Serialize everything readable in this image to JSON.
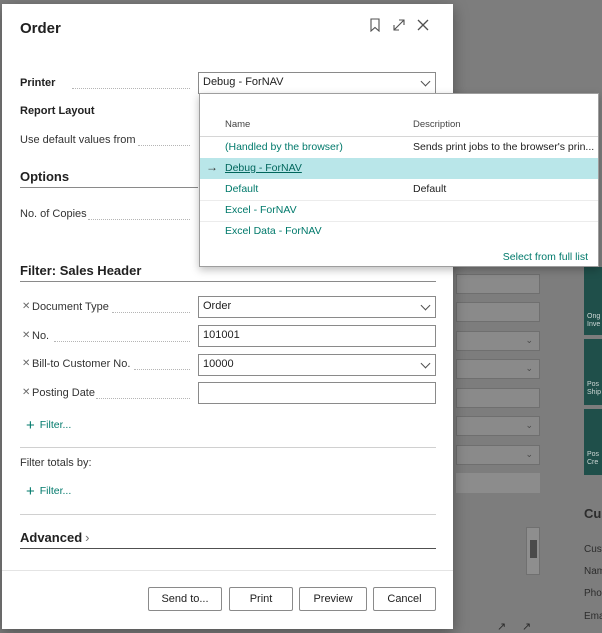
{
  "dialog": {
    "title": "Order",
    "icons": {
      "bookmark": "bookmark-icon",
      "expand": "expand-icon",
      "close": "close-icon"
    }
  },
  "fields": {
    "printer_label": "Printer",
    "printer_value": "Debug - ForNAV",
    "report_layout_label": "Report Layout",
    "default_values_label": "Use default values from"
  },
  "options": {
    "title": "Options",
    "copies_label": "No. of Copies"
  },
  "filter_sales_header": {
    "title": "Filter: Sales Header",
    "rows": [
      {
        "label": "Document Type",
        "value": "Order",
        "dropdown": true
      },
      {
        "label": "No.",
        "value": "101001",
        "dropdown": false
      },
      {
        "label": "Bill-to Customer No.",
        "value": "10000",
        "dropdown": true
      },
      {
        "label": "Posting Date",
        "value": "",
        "dropdown": false
      }
    ],
    "add_filter": "Filter..."
  },
  "filter_totals": {
    "label": "Filter totals by:",
    "add_filter": "Filter..."
  },
  "advanced": {
    "title": "Advanced"
  },
  "buttons": {
    "send_to": "Send to...",
    "print": "Print",
    "preview": "Preview",
    "cancel": "Cancel"
  },
  "printer_popup": {
    "col_name": "Name",
    "col_description": "Description",
    "rows": [
      {
        "name": "(Handled by the browser)",
        "description": "Sends print jobs to the browser's prin..."
      },
      {
        "name": "Debug - ForNAV",
        "description": "",
        "selected": true
      },
      {
        "name": "Default",
        "description": "Default"
      },
      {
        "name": "Excel - ForNAV",
        "description": ""
      },
      {
        "name": "Excel Data - ForNAV",
        "description": ""
      }
    ],
    "select_full_list": "Select from full list"
  },
  "background": {
    "tiles": [
      "Ong Inve",
      "Pos Ship",
      "Pos Cre"
    ],
    "section": "Cus",
    "labels": [
      "Cust",
      "Nam",
      "Pho",
      "Ema"
    ]
  },
  "colors": {
    "accent": "#00796b",
    "selected_row": "#b9e6e9",
    "tile": "#1f4f4a"
  }
}
